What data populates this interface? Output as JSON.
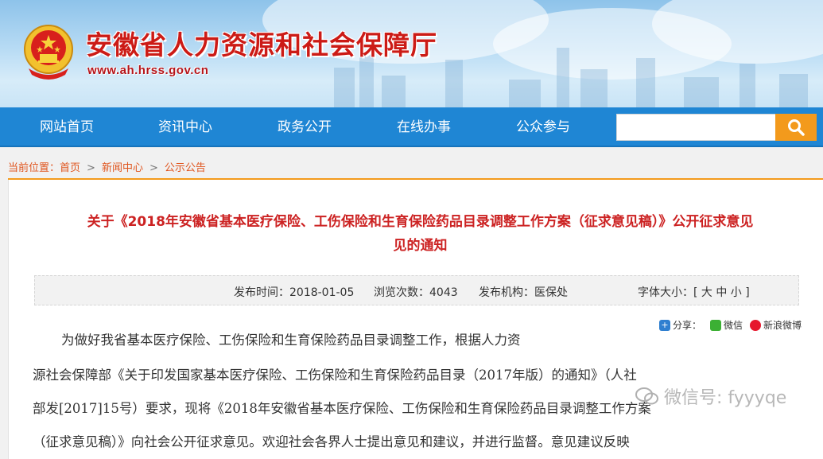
{
  "header": {
    "site_title": "安徽省人力资源和社会保障厅",
    "site_url": "www.ah.hrss.gov.cn"
  },
  "nav": {
    "items": [
      "网站首页",
      "资讯中心",
      "政务公开",
      "在线办事",
      "公众参与"
    ],
    "search_placeholder": ""
  },
  "breadcrumb": {
    "prefix": "当前位置：",
    "items": [
      "首页",
      "新闻中心",
      "公示公告"
    ],
    "separator": ">"
  },
  "article": {
    "title_line1": "关于《2018年安徽省基本医疗保险、工伤保险和生育保险药品目录调整工作方案（征求意见稿）》公开征求意见",
    "title_line2": "见的通知",
    "publish_time": "发布时间：2018-01-05",
    "views": "浏览次数：4043",
    "publisher": "发布机构：医保处",
    "font_size_label": "字体大小：[ 大  中  小 ]",
    "share_label": "分享：",
    "share_wechat": "微信",
    "share_weibo": "新浪微博",
    "body_lines": [
      "为做好我省基本医疗保险、工伤保险和生育保险药品目录调整工作，根据人力资",
      "源社会保障部《关于印发国家基本医疗保险、工伤保险和生育保险药品目录（2017年版）的通知》（人社",
      "部发[2017]15号）要求，现将《2018年安徽省基本医疗保险、工伤保险和生育保险药品目录调整工作方案",
      "（征求意见稿）》向社会公开征求意见。欢迎社会各界人士提出意见和建议，并进行监督。意见建议反映"
    ]
  },
  "watermark": {
    "text": "微信号: fyyyqe"
  },
  "colors": {
    "nav_bg": "#1f86d4",
    "search_btn": "#f39a1c",
    "title_red": "#cc2222",
    "crumb_orange": "#e0551e"
  }
}
